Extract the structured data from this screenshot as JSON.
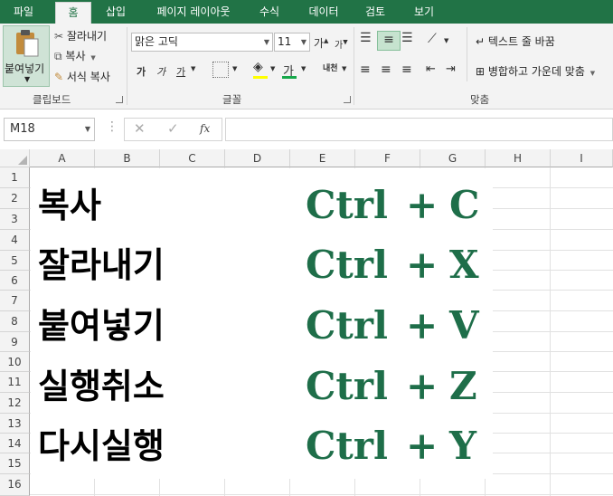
{
  "tabs": [
    "파일",
    "홈",
    "삽입",
    "페이지 레이아웃",
    "수식",
    "데이터",
    "검토",
    "보기"
  ],
  "clipboard": {
    "paste_label": "붙여넣기",
    "cut_label": "잘라내기",
    "copy_label": "복사",
    "format_painter_label": "서식 복사",
    "group_label": "클립보드"
  },
  "font": {
    "family_value": "맑은 고딕",
    "size_value": "11",
    "grow_label": "가",
    "shrink_label": "가",
    "bold_label": "가",
    "italic_label": "가",
    "underline_label": "가",
    "font_color_label": "가",
    "phonetic_label": "내천",
    "group_label": "글꼴"
  },
  "alignment": {
    "wrap_text_label": "텍스트 줄 바꿈",
    "merge_center_label": "병합하고 가운데 맞춤",
    "group_label": "맞춤"
  },
  "formula_bar": {
    "name_box": "M18",
    "fx_label": "fx",
    "cancel_label": "✕",
    "enter_label": "✓",
    "formula_value": ""
  },
  "columns": [
    "A",
    "B",
    "C",
    "D",
    "E",
    "F",
    "G",
    "H",
    "I"
  ],
  "rows": [
    "1",
    "2",
    "3",
    "4",
    "5",
    "6",
    "7",
    "8",
    "9",
    "10",
    "11",
    "12",
    "13",
    "14",
    "15",
    "16"
  ],
  "shortcuts": [
    {
      "action": "복사",
      "key1": "Ctrl",
      "plus": "+",
      "key2": "C"
    },
    {
      "action": "잘라내기",
      "key1": "Ctrl",
      "plus": "+",
      "key2": "X"
    },
    {
      "action": "붙여넣기",
      "key1": "Ctrl",
      "plus": "+",
      "key2": "V"
    },
    {
      "action": "실행취소",
      "key1": "Ctrl",
      "plus": "+",
      "key2": "Z"
    },
    {
      "action": "다시실행",
      "key1": "Ctrl",
      "plus": "+",
      "key2": "Y"
    }
  ],
  "colors": {
    "excel_green": "#217346",
    "shortcut_green": "#1e6e49"
  }
}
